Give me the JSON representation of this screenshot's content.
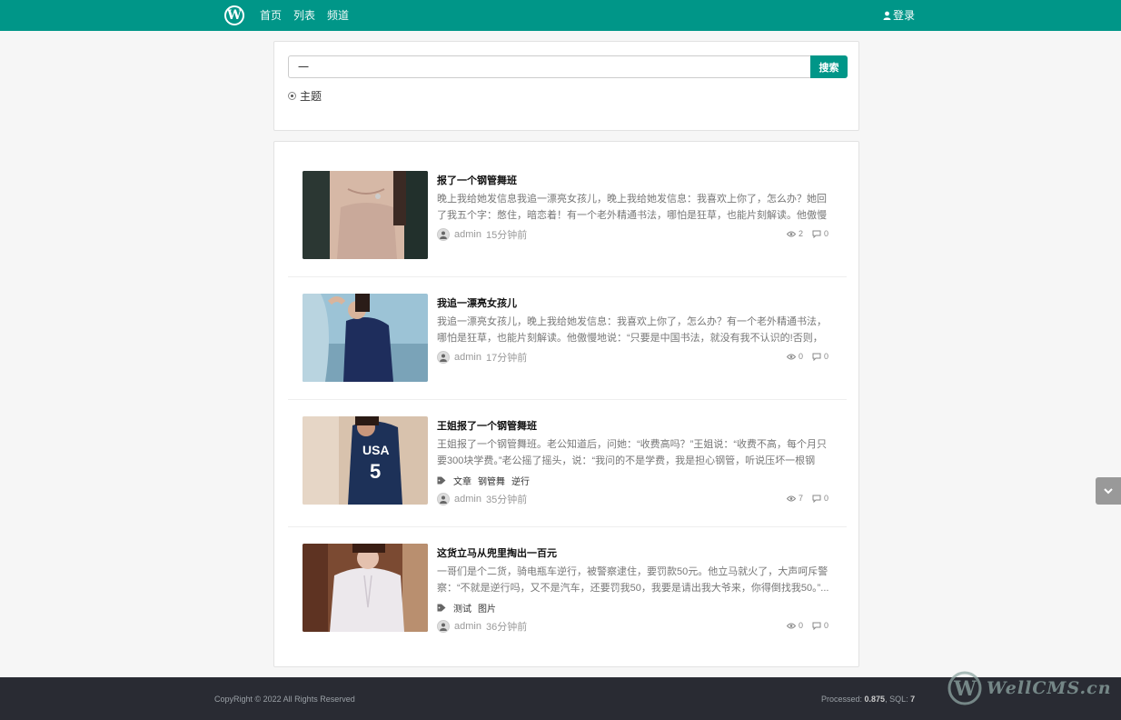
{
  "header": {
    "logo_letter": "W",
    "nav": [
      "首页",
      "列表",
      "频道"
    ],
    "login_label": "登录"
  },
  "search": {
    "value": "一",
    "button_label": "搜索",
    "option_label": "主题"
  },
  "posts": [
    {
      "title": "报了一个钢管舞班",
      "excerpt": "晚上我给她发信息我追一漂亮女孩儿，晚上我给她发信息：我喜欢上你了，怎么办？她回了我五个字：憋住，暗恋着！有一个老外精通书法，哪怕是狂草，也能片刻解读。他傲慢地...",
      "tags": [],
      "author": "admin",
      "time": "15分钟前",
      "views": "2",
      "comments": "0"
    },
    {
      "title": "我追一漂亮女孩儿",
      "excerpt": "我追一漂亮女孩儿，晚上我给她发信息：我喜欢上你了，怎么办？有一个老外精通书法，哪怕是狂草，也能片刻解读。他傲慢地说：“只要是中国书法，就没有我不认识的!否则，我...",
      "tags": [],
      "author": "admin",
      "time": "17分钟前",
      "views": "0",
      "comments": "0"
    },
    {
      "title": "王姐报了一个钢管舞班",
      "excerpt": "王姐报了一个钢管舞班。老公知道后，问她：“收费高吗？”王姐说：“收费不高，每个月只要300块学费。”老公摇了摇头，说：“我问的不是学费，我是担心钢管，听说压坏一根钢管...",
      "tags": [
        "文章",
        "钢管舞",
        "逆行"
      ],
      "author": "admin",
      "time": "35分钟前",
      "views": "7",
      "comments": "0"
    },
    {
      "title": "这货立马从兜里掏出一百元",
      "excerpt": "一哥们是个二货，骑电瓶车逆行，被警察逮住，要罚款50元。他立马就火了，大声呵斥警察：“不就是逆行吗，又不是汽车，还要罚我50，我要是请出我大爷来，你得倒找我50。”...",
      "tags": [
        "测试",
        "图片"
      ],
      "author": "admin",
      "time": "36分钟前",
      "views": "0",
      "comments": "0"
    }
  ],
  "footer": {
    "copyright": "CopyRight © 2022 All Rights Reserved",
    "processed_label": "Processed: ",
    "processed_value": "0.875",
    "sql_label": ", SQL: ",
    "sql_value": "7"
  },
  "watermark": {
    "text": "WellCMS.cn"
  },
  "colors": {
    "brand": "#009688",
    "footer": "#292b33"
  }
}
